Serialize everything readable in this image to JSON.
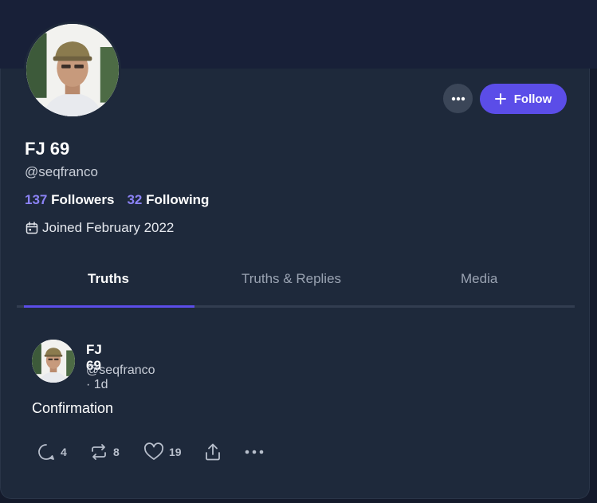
{
  "profile": {
    "display_name": "FJ 69",
    "handle": "@seqfranco",
    "followers_count": "137",
    "followers_label": "Followers",
    "following_count": "32",
    "following_label": "Following",
    "joined": "Joined February 2022",
    "follow_label": "Follow"
  },
  "tabs": [
    {
      "label": "Truths",
      "active": true
    },
    {
      "label": "Truths & Replies",
      "active": false
    },
    {
      "label": "Media",
      "active": false
    }
  ],
  "post": {
    "author": "FJ 69",
    "meta": "@seqfranco · 1d",
    "text": "Confirmation",
    "replies": "4",
    "retruths": "8",
    "likes": "19"
  },
  "colors": {
    "accent": "#5b4de8",
    "count_accent": "#8b82f5",
    "card": "#1e293b",
    "background": "#141a2b"
  },
  "icons": [
    "more-icon",
    "plus-icon",
    "calendar-icon",
    "reply-icon",
    "retruth-icon",
    "like-icon",
    "share-icon"
  ]
}
